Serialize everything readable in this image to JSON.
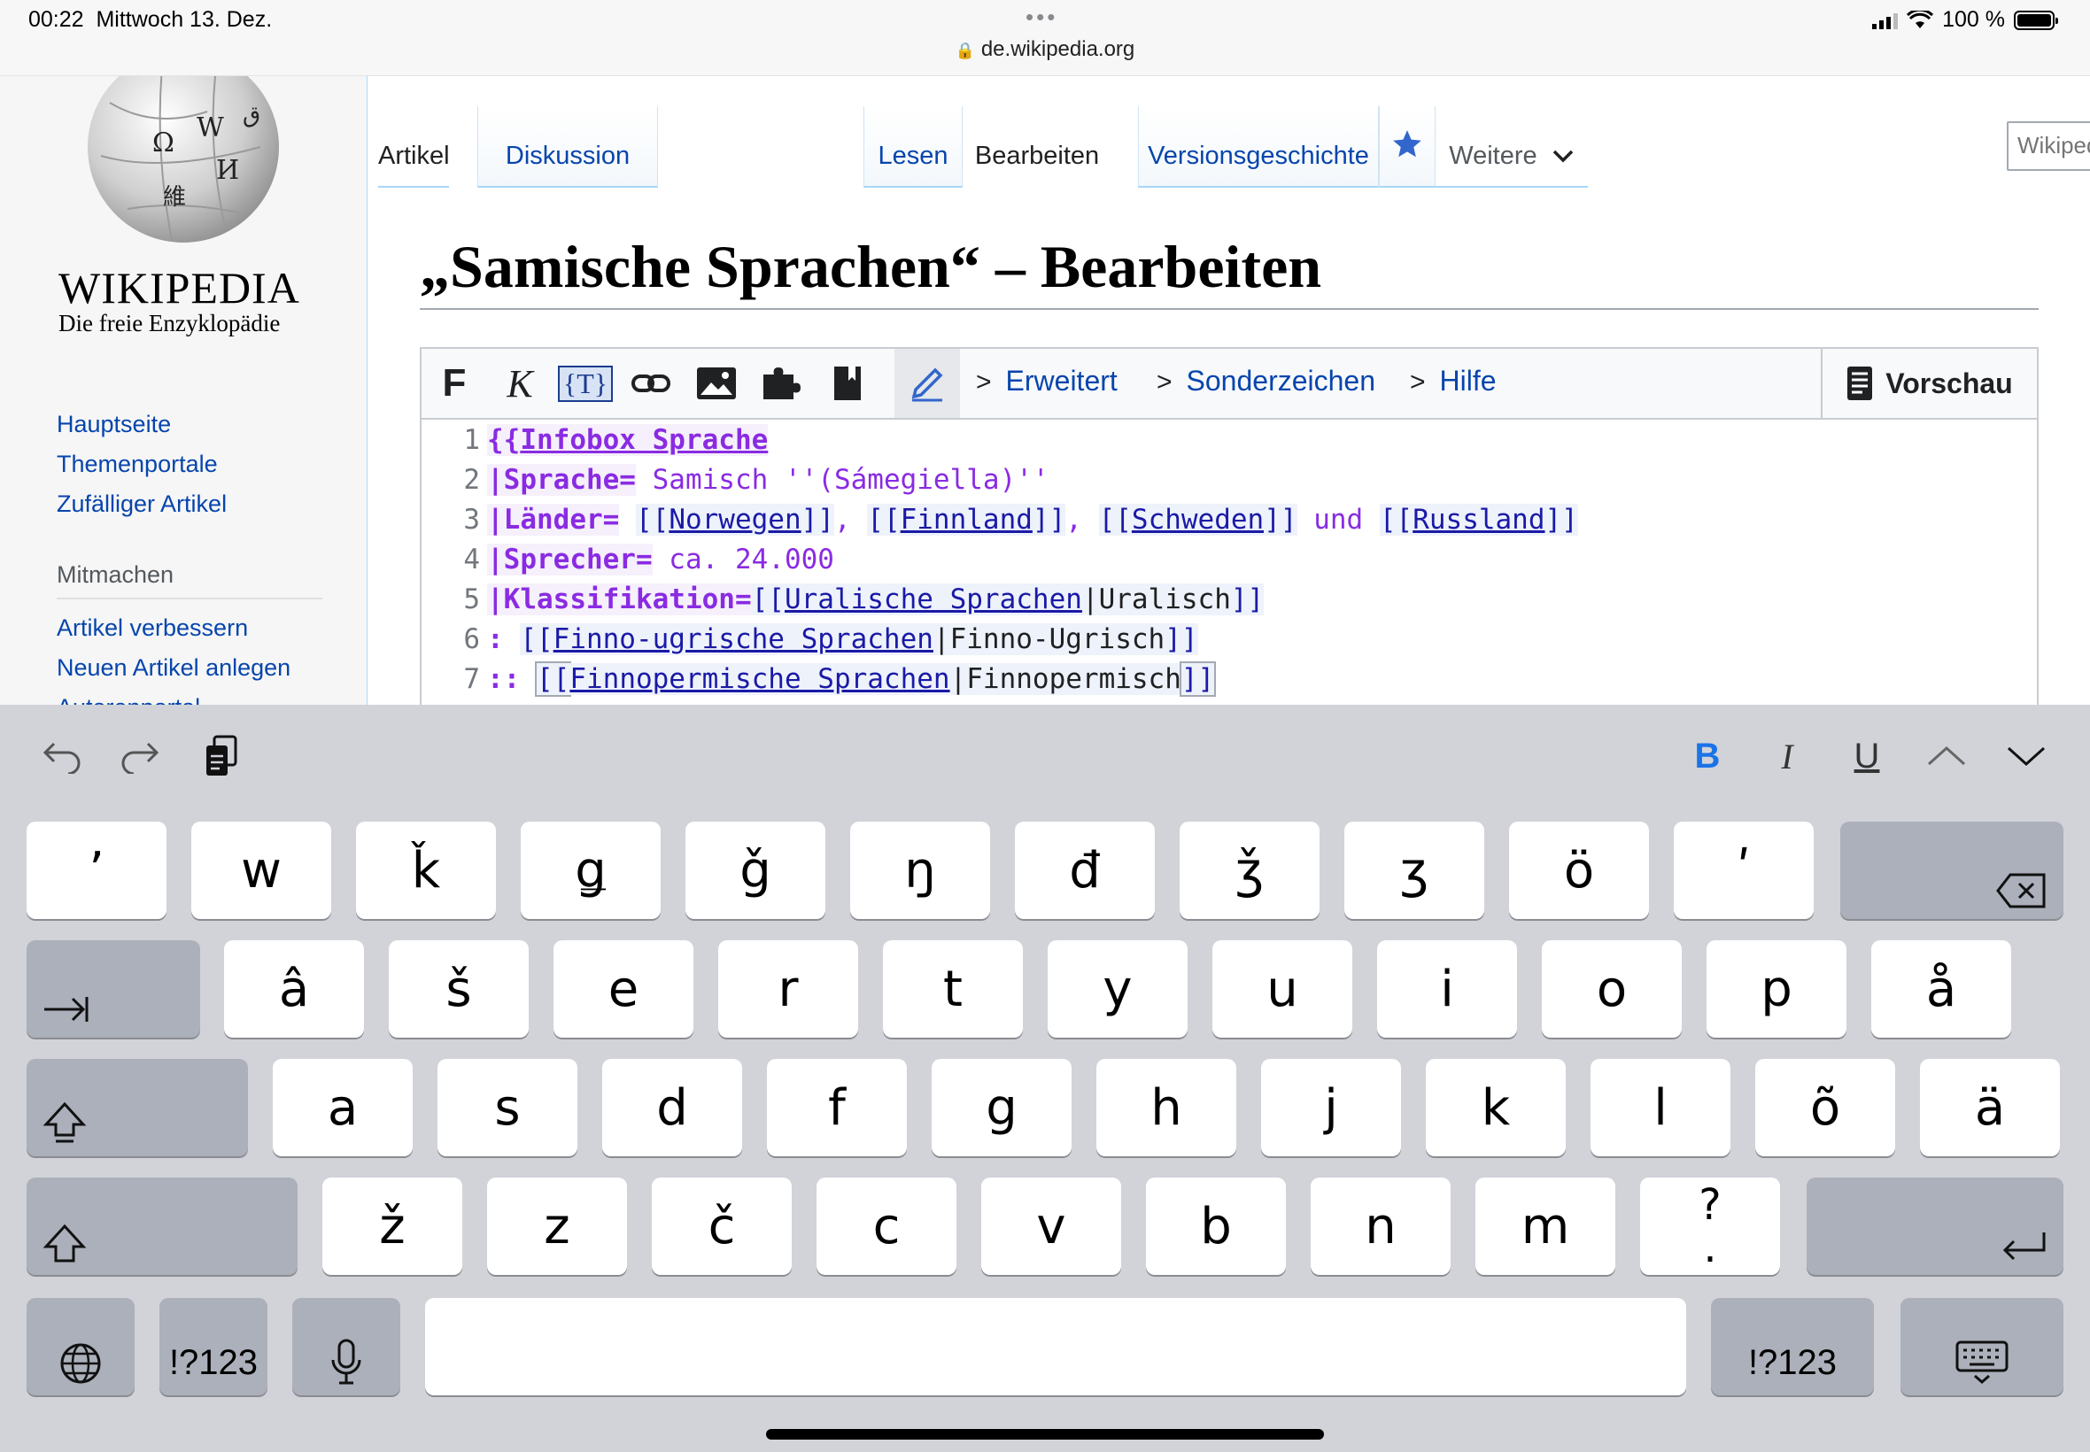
{
  "status": {
    "time": "00:22",
    "date": "Mittwoch 13. Dez.",
    "battery": "100 %",
    "url": "de.wikipedia.org"
  },
  "sidebar": {
    "wordmark": "WIKIPEDIA",
    "tagline": "Die freie Enzyklopädie",
    "nav": [
      "Hauptseite",
      "Themenportale",
      "Zufälliger Artikel"
    ],
    "section_title": "Mitmachen",
    "mitmachen": [
      "Artikel verbessern",
      "Neuen Artikel anlegen",
      "Autorenportal"
    ]
  },
  "tabs": {
    "artikel": "Artikel",
    "diskussion": "Diskussion",
    "lesen": "Lesen",
    "bearbeiten": "Bearbeiten",
    "versionen": "Versionsgeschichte",
    "weitere": "Weitere"
  },
  "search": {
    "placeholder": "Wikipedia durchsuchen"
  },
  "title": "„Samische Sprachen“ – Bearbeiten",
  "toolbar": {
    "bold": "F",
    "italic": "K",
    "template": "{T}",
    "erweitert": "Erweitert",
    "sonderzeichen": "Sonderzeichen",
    "hilfe": "Hilfe",
    "vorschau": "Vorschau"
  },
  "code": {
    "n": [
      "1",
      "2",
      "3",
      "4",
      "5",
      "6",
      "7"
    ],
    "l1": {
      "open": "{{",
      "link": "Infobox Sprache"
    },
    "l2": {
      "param": "|Sprache=",
      "value": " Samisch ''(Sámegiella)''"
    },
    "l3": {
      "param": "|Länder=",
      "sp": " ",
      "b1o": "[[",
      "link1": "Norwegen",
      "b1c": "]]",
      "sep1": ", ",
      "b2o": "[[",
      "link2": "Finnland",
      "b2c": "]]",
      "sep2": ", ",
      "b3o": "[[",
      "link3": "Schweden",
      "b3c": "]]",
      "und": " und ",
      "b4o": "[[",
      "link4": "Russland",
      "b4c": "]]"
    },
    "l4": {
      "param": "|Sprecher=",
      "value": " ca. 24.000"
    },
    "l5": {
      "param": "|Klassifikation=",
      "bo": "[[",
      "link": "Uralische Sprachen",
      "pipe": "|Uralisch",
      "bc": "]]"
    },
    "l6": {
      "indent": ": ",
      "bo": "[[",
      "link": "Finno-ugrische Sprachen",
      "pipe": "|Finno-Ugrisch",
      "bc": "]]"
    },
    "l7": {
      "indent": ":: ",
      "bo": "[[",
      "link": "Finnopermische Sprachen",
      "pipe": "|Finnopermisch",
      "bc": "]]"
    }
  },
  "keyboard": {
    "format": {
      "bold": "B",
      "italic": "I",
      "underline": "U"
    },
    "row1": [
      "ʼ",
      "w",
      "ǩ",
      "ǥ",
      "ǧ",
      "ŋ",
      "đ",
      "ǯ",
      "ʒ",
      "ö",
      "ʹ"
    ],
    "row2": [
      "â",
      "š",
      "e",
      "r",
      "t",
      "y",
      "u",
      "i",
      "o",
      "p",
      "å"
    ],
    "row3": [
      "a",
      "s",
      "d",
      "f",
      "g",
      "h",
      "j",
      "k",
      "l",
      "õ",
      "ä"
    ],
    "row4": [
      "ž",
      "z",
      "č",
      "c",
      "v",
      "b",
      "n",
      "m"
    ],
    "punct_top": "?",
    "punct_bottom": ".",
    "numbers": "!?123"
  }
}
